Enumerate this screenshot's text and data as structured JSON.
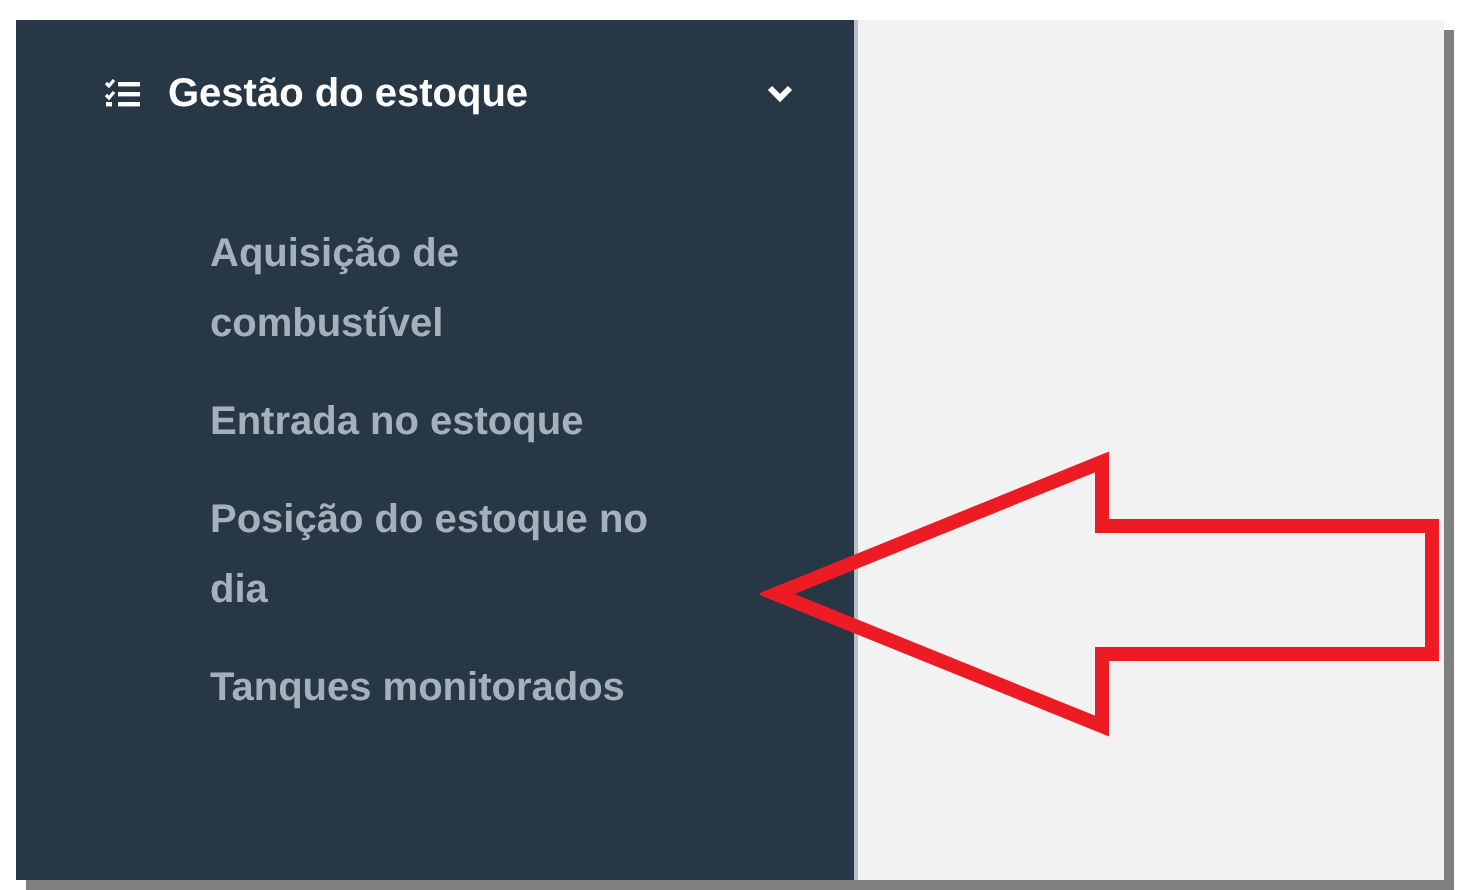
{
  "sidebar": {
    "group": {
      "label": "Gestão do estoque",
      "expanded": true
    },
    "items": [
      {
        "label": "Aquisição de combustível"
      },
      {
        "label": "Entrada no estoque"
      },
      {
        "label": "Posição do estoque no dia"
      },
      {
        "label": "Tanques monitorados"
      }
    ]
  }
}
